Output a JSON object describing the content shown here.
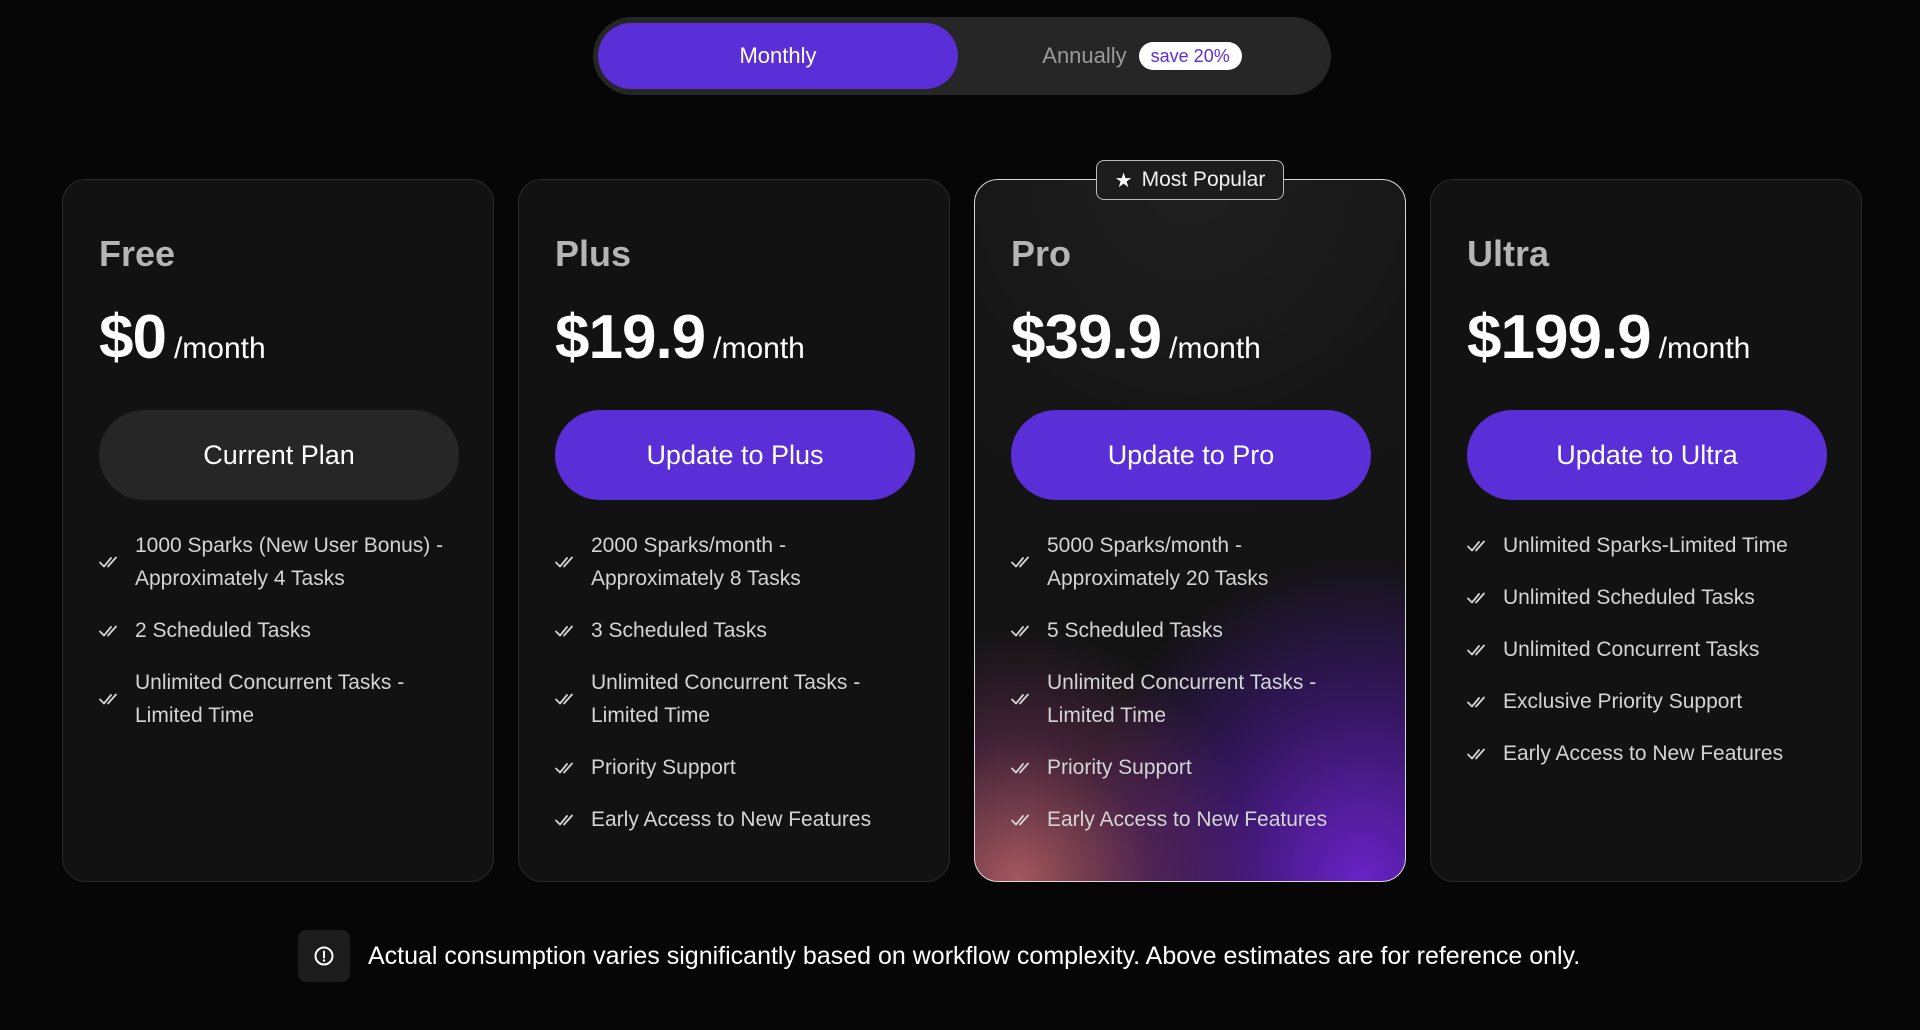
{
  "billing_toggle": {
    "monthly_label": "Monthly",
    "annually_label": "Annually",
    "save_badge": "save 20%",
    "selected": "Monthly"
  },
  "popular_badge": "Most Popular",
  "plans": [
    {
      "name": "Free",
      "price": "$0",
      "period": "/month",
      "cta": "Current Plan",
      "features": [
        "1000 Sparks (New User Bonus) - Approximately 4 Tasks",
        "2 Scheduled Tasks",
        "Unlimited Concurrent Tasks - Limited Time"
      ]
    },
    {
      "name": "Plus",
      "price": "$19.9",
      "period": "/month",
      "cta": "Update to Plus",
      "features": [
        "2000 Sparks/month - Approximately 8 Tasks",
        "3 Scheduled Tasks",
        "Unlimited Concurrent Tasks - Limited Time",
        "Priority Support",
        "Early Access to New Features"
      ]
    },
    {
      "name": "Pro",
      "price": "$39.9",
      "period": "/month",
      "cta": "Update to Pro",
      "features": [
        "5000 Sparks/month - Approximately 20 Tasks",
        "5 Scheduled Tasks",
        "Unlimited Concurrent Tasks - Limited Time",
        "Priority Support",
        "Early Access to New Features"
      ]
    },
    {
      "name": "Ultra",
      "price": "$199.9",
      "period": "/month",
      "cta": "Update to Ultra",
      "features": [
        "Unlimited Sparks-Limited Time",
        "Unlimited Scheduled Tasks",
        "Unlimited Concurrent Tasks",
        "Exclusive Priority Support",
        "Early Access to New Features"
      ]
    }
  ],
  "note": "Actual consumption varies significantly based on workflow complexity. Above estimates are for reference only.",
  "colors": {
    "accent": "#5b2fd8",
    "background": "#060606",
    "card": "#121212"
  },
  "icons": {
    "feature": "double-check-icon",
    "popular": "star-icon",
    "note": "info-icon"
  }
}
